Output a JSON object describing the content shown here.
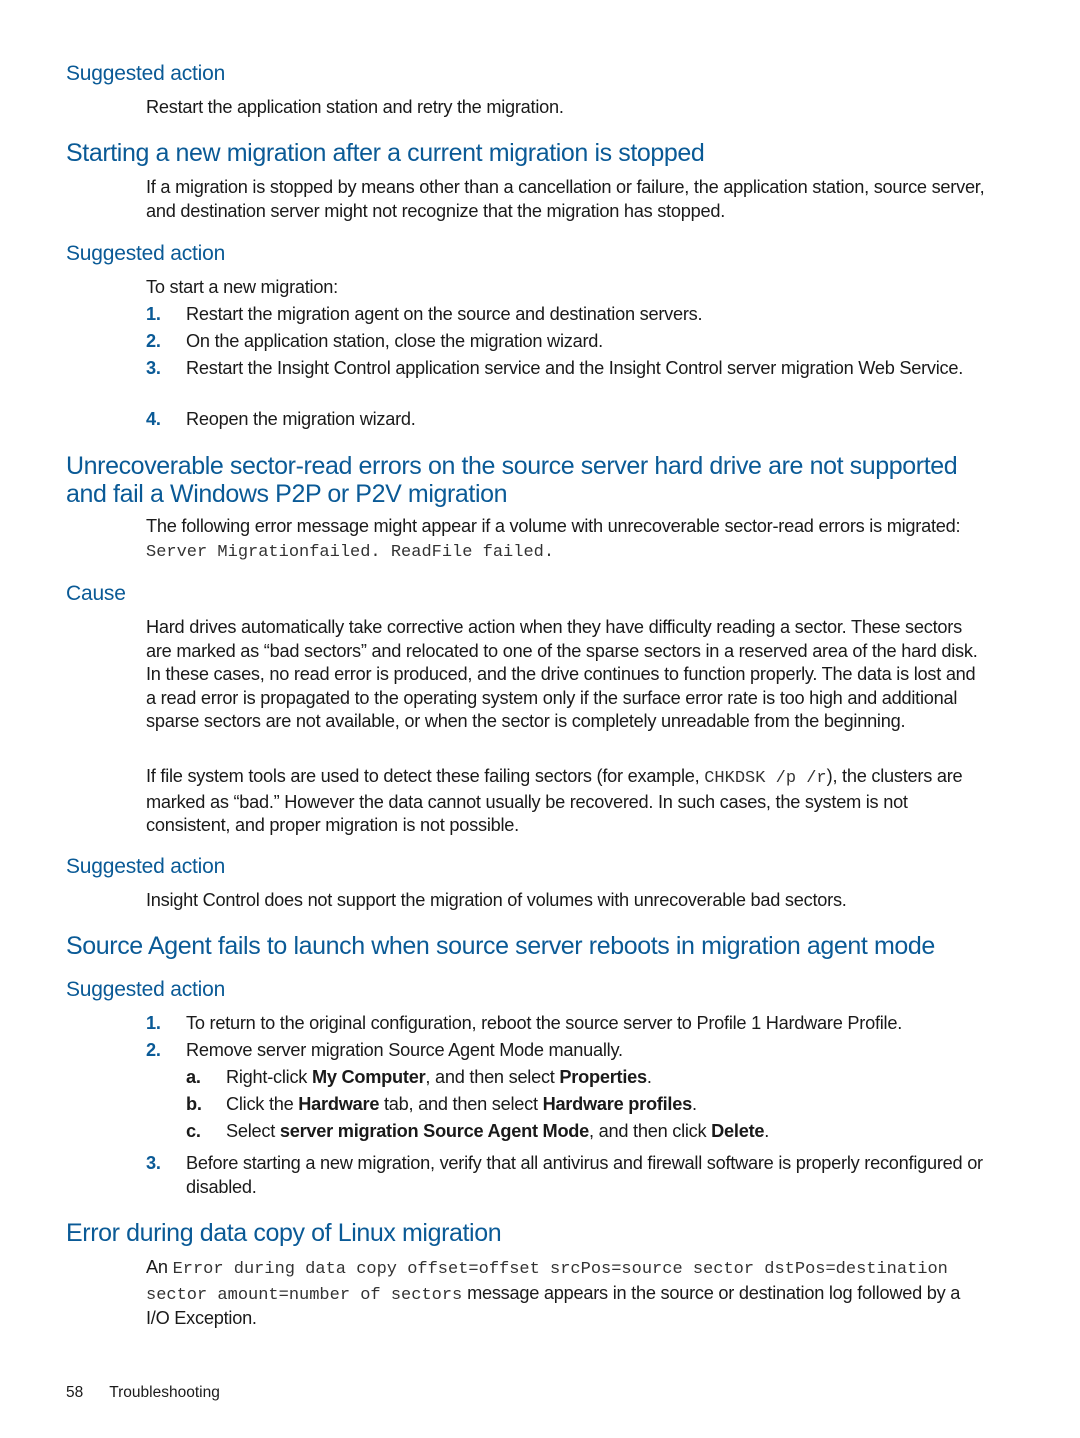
{
  "sections": {
    "s0": {
      "suggested_label": "Suggested action",
      "text": "Restart the application station and retry the migration."
    },
    "s1": {
      "title": "Starting a new migration after a current migration is stopped",
      "body": "If a migration is stopped by means other than a cancellation or failure, the application station, source server, and destination server might not recognize that the migration has stopped.",
      "suggested_label": "Suggested action",
      "intro": "To start a new migration:",
      "steps": [
        {
          "num": "1.",
          "text": "Restart the migration agent on the source and destination servers."
        },
        {
          "num": "2.",
          "text": "On the application station, close the migration wizard."
        },
        {
          "num": "3.",
          "text": "Restart the Insight Control application service and the Insight Control server migration Web Service."
        },
        {
          "num": "4.",
          "text": "Reopen the migration wizard."
        }
      ]
    },
    "s2": {
      "title": "Unrecoverable sector-read errors on the source server hard drive are not supported and fail a Windows P2P or P2V migration",
      "body_prefix": "The following error message might appear if a volume with unrecoverable sector-read errors is migrated: ",
      "body_code": "Server Migrationfailed. ReadFile failed.",
      "cause_label": "Cause",
      "cause_p1": "Hard drives automatically take corrective action when they have difficulty reading a sector. These sectors are marked as “bad sectors” and relocated to one of the sparse sectors in a reserved area of the hard disk. In these cases, no read error is produced, and the drive continues to function properly. The data is lost and a read error is propagated to the operating system only if the surface error rate is too high and additional sparse sectors are not available, or when the sector is completely unreadable from the beginning.",
      "cause_p2_prefix": "If file system tools are used to detect these failing sectors (for example, ",
      "cause_p2_code": "CHKDSK /p /r",
      "cause_p2_suffix": "), the clusters are marked as “bad.” However the data cannot usually be recovered. In such cases, the system is not consistent, and proper migration is not possible.",
      "suggested_label": "Suggested action",
      "suggested_text": "Insight Control does not support the migration of volumes with unrecoverable bad sectors."
    },
    "s3": {
      "title": "Source Agent fails to launch when source server reboots in migration agent mode",
      "suggested_label": "Suggested action",
      "step1": {
        "num": "1.",
        "text": "To return to the original configuration, reboot the source server to Profile 1 Hardware Profile."
      },
      "step2": {
        "num": "2.",
        "text": "Remove server migration Source Agent Mode manually."
      },
      "sub_a": {
        "let": "a.",
        "t1": "Right-click ",
        "b1": "My Computer",
        "t2": ", and then select ",
        "b2": "Properties",
        "t3": "."
      },
      "sub_b": {
        "let": "b.",
        "t1": "Click the ",
        "b1": "Hardware",
        "t2": " tab, and then select ",
        "b2": "Hardware profiles",
        "t3": "."
      },
      "sub_c": {
        "let": "c.",
        "t1": "Select ",
        "b1": "server migration Source Agent Mode",
        "t2": ", and then click ",
        "b2": "Delete",
        "t3": "."
      },
      "step3": {
        "num": "3.",
        "text": "Before starting a new migration, verify that all antivirus and firewall software is properly reconfigured or disabled."
      }
    },
    "s4": {
      "title": "Error during data copy of Linux migration",
      "prefix": "An ",
      "code": "Error during data copy offset=offset srcPos=source sector dstPos=destination sector amount=number of sectors",
      "suffix": " message appears in the source or destination log followed by a I/O Exception."
    }
  },
  "footer": {
    "page_number": "58",
    "section": "Troubleshooting"
  },
  "colors": {
    "heading": "#0a5a96",
    "text": "#1a1a1a"
  }
}
